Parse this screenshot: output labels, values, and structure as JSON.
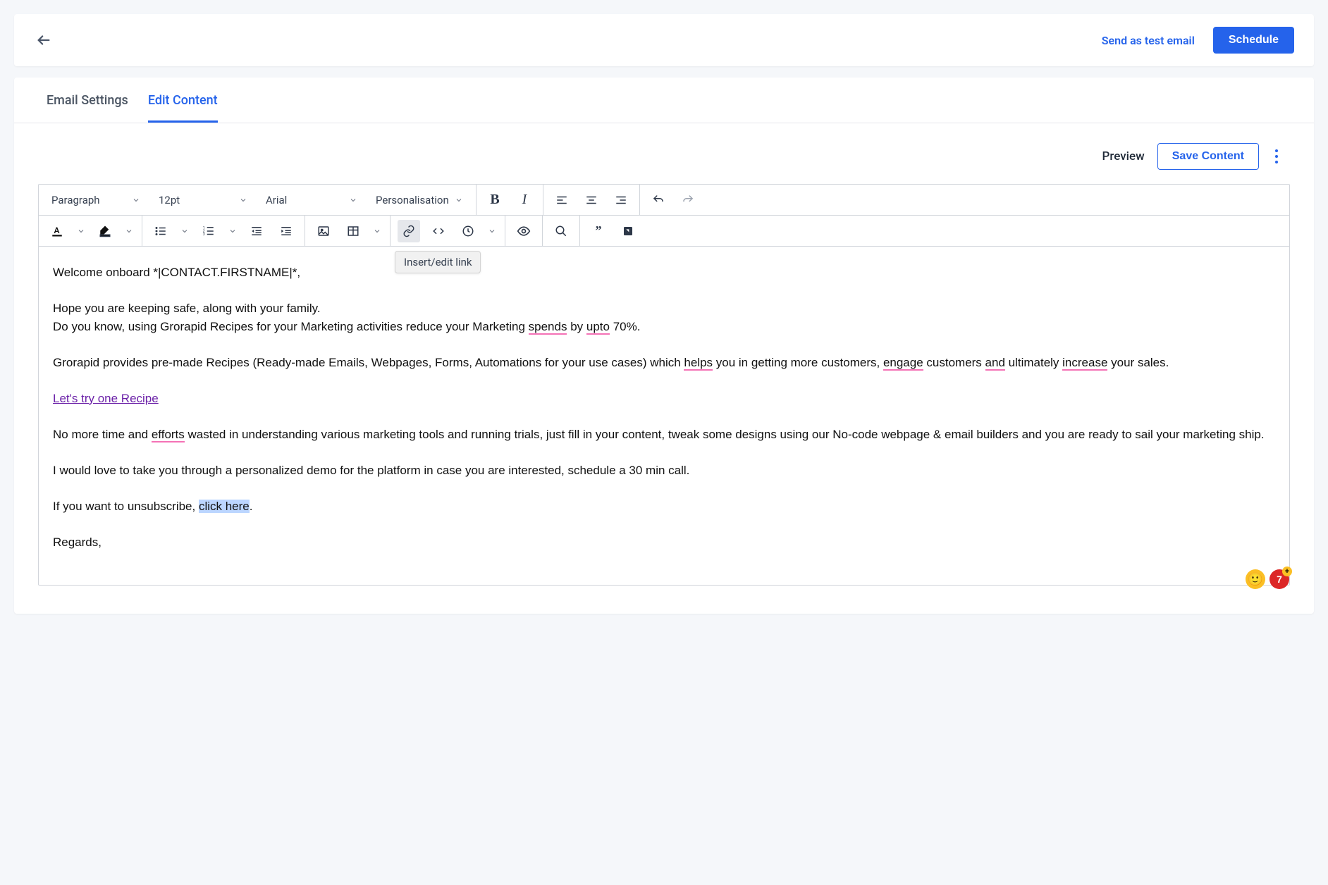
{
  "header": {
    "send_test_label": "Send as test email",
    "schedule_label": "Schedule"
  },
  "tabs": {
    "email_settings": "Email Settings",
    "edit_content": "Edit Content"
  },
  "actions": {
    "preview": "Preview",
    "save_content": "Save Content"
  },
  "toolbar": {
    "block_format": "Paragraph",
    "font_size": "12pt",
    "font_family": "Arial",
    "personalisation": "Personalisation",
    "link_tooltip": "Insert/edit link"
  },
  "body": {
    "p1_a": "Welcome onboard *|CONTACT.FIRSTNAME|*,",
    "p2_a": "Hope you are keeping safe, along with your family.",
    "p3_pre": "Do you know, using Grorapid Recipes for your Marketing activities reduce your Marketing ",
    "p3_s1": "spends",
    "p3_mid1": " by ",
    "p3_s2": "upto",
    "p3_post": " 70%.",
    "p4_pre": "Grorapid provides pre-made Recipes (Ready-made Emails, Webpages, Forms, Automations for your use cases) which ",
    "p4_s1": "helps",
    "p4_mid1": " you in getting more customers, ",
    "p4_s2": "engage",
    "p4_mid2": " customers ",
    "p4_s3": "and",
    "p4_mid3": " ultimately ",
    "p4_s4": "increase",
    "p4_post": " your sales.",
    "link1": "Let's try one Recipe",
    "p5_pre": "No more time and ",
    "p5_s1": "efforts",
    "p5_post": " wasted in understanding various marketing tools and running trials, just fill in your content, tweak some designs using our No-code webpage & email builders and you are ready to sail your marketing ship.",
    "p6": "I would love to take you through a personalized demo for the platform in case you are interested, schedule a 30 min call.",
    "p7_pre": "If you want to unsubscribe, ",
    "p7_sel": "click here",
    "p7_post": ".",
    "p8": "Regards,"
  },
  "badges": {
    "red_value": "7",
    "plus": "+"
  }
}
